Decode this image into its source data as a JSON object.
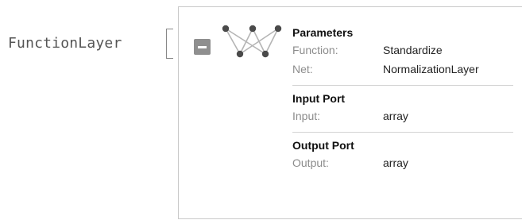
{
  "expression": {
    "head": "FunctionLayer"
  },
  "panel": {
    "collapse_icon": "minus-square-icon",
    "graph_icon": "neural-network-icon",
    "sections": [
      {
        "title": "Parameters",
        "rows": [
          {
            "label": "Function:",
            "value": "Standardize"
          },
          {
            "label": "Net:",
            "value": "NormalizationLayer"
          }
        ]
      },
      {
        "title": "Input Port",
        "rows": [
          {
            "label": "Input:",
            "value": "array"
          }
        ]
      },
      {
        "title": "Output Port",
        "rows": [
          {
            "label": "Output:",
            "value": "array"
          }
        ]
      }
    ]
  },
  "colors": {
    "label": "#8c8c8c",
    "value": "#222222",
    "border": "#c9c9c9",
    "button": "#8f8f8f",
    "node": "#4a4a4a",
    "edge": "#b5b5b5"
  }
}
